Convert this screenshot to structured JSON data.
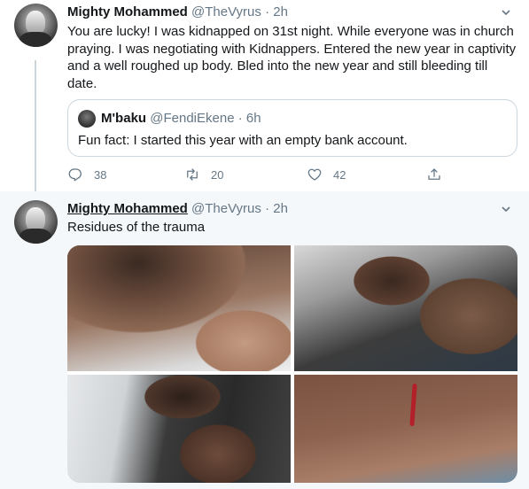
{
  "tweets": [
    {
      "name": "Mighty Mohammed",
      "handle": "@TheVyrus",
      "dot": "·",
      "time": "2h",
      "text": "You are lucky! I was kidnapped on 31st night. While everyone was in church praying. I was negotiating with Kidnappers. Entered the new year in captivity and a well roughed up body. Bled into the new year and still bleeding till date.",
      "quote": {
        "name": "M'baku",
        "handle": "@FendiEkene",
        "dot": "·",
        "time": "6h",
        "text": "Fun fact: I started this year with an empty bank account."
      },
      "actions": {
        "reply_count": "38",
        "retweet_count": "20",
        "like_count": "42"
      }
    },
    {
      "name": "Mighty Mohammed",
      "handle": "@TheVyrus",
      "dot": "·",
      "time": "2h",
      "text": "Residues of the trauma"
    }
  ],
  "icons": {
    "reply": "reply-icon",
    "retweet": "retweet-icon",
    "like": "heart-icon",
    "share": "share-icon",
    "more": "chevron-down-icon"
  },
  "colors": {
    "text": "#14171a",
    "secondary": "#657786",
    "border": "#ccd6dd",
    "thread_bg": "#f5f8fa",
    "wound": "#b3202a"
  }
}
